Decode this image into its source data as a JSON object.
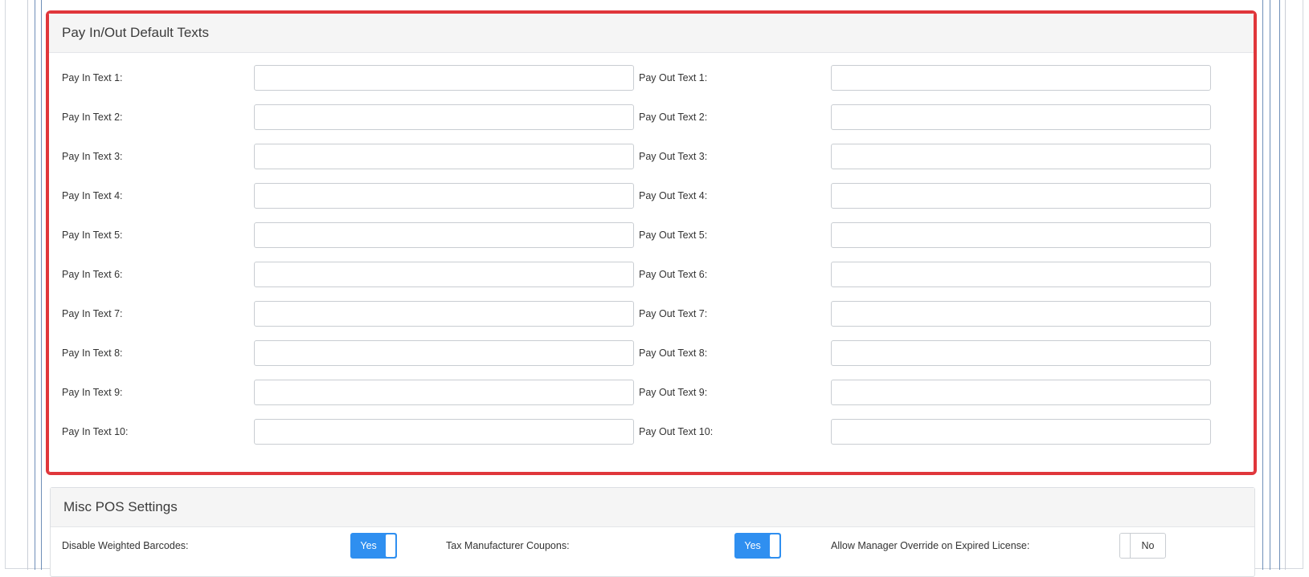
{
  "pay_panel": {
    "title": "Pay In/Out Default Texts",
    "pay_in": [
      {
        "label": "Pay In Text 1:",
        "value": ""
      },
      {
        "label": "Pay In Text 2:",
        "value": ""
      },
      {
        "label": "Pay In Text 3:",
        "value": ""
      },
      {
        "label": "Pay In Text 4:",
        "value": ""
      },
      {
        "label": "Pay In Text 5:",
        "value": ""
      },
      {
        "label": "Pay In Text 6:",
        "value": ""
      },
      {
        "label": "Pay In Text 7:",
        "value": ""
      },
      {
        "label": "Pay In Text 8:",
        "value": ""
      },
      {
        "label": "Pay In Text 9:",
        "value": ""
      },
      {
        "label": "Pay In Text 10:",
        "value": ""
      }
    ],
    "pay_out": [
      {
        "label": "Pay Out Text 1:",
        "value": ""
      },
      {
        "label": "Pay Out Text 2:",
        "value": ""
      },
      {
        "label": "Pay Out Text 3:",
        "value": ""
      },
      {
        "label": "Pay Out Text 4:",
        "value": ""
      },
      {
        "label": "Pay Out Text 5:",
        "value": ""
      },
      {
        "label": "Pay Out Text 6:",
        "value": ""
      },
      {
        "label": "Pay Out Text 7:",
        "value": ""
      },
      {
        "label": "Pay Out Text 8:",
        "value": ""
      },
      {
        "label": "Pay Out Text 9:",
        "value": ""
      },
      {
        "label": "Pay Out Text 10:",
        "value": ""
      }
    ]
  },
  "misc_panel": {
    "title": "Misc POS Settings",
    "settings": [
      {
        "label": "Disable Weighted Barcodes:",
        "toggle": "Yes",
        "on": true
      },
      {
        "label": "Tax Manufacturer Coupons:",
        "toggle": "Yes",
        "on": true
      },
      {
        "label": "Allow Manager Override on Expired License:",
        "toggle": "No",
        "on": false
      }
    ]
  },
  "colors": {
    "highlight": "#e0363b",
    "toggle_on": "#2f8ff0",
    "panel_heading_bg": "#f5f5f5"
  }
}
